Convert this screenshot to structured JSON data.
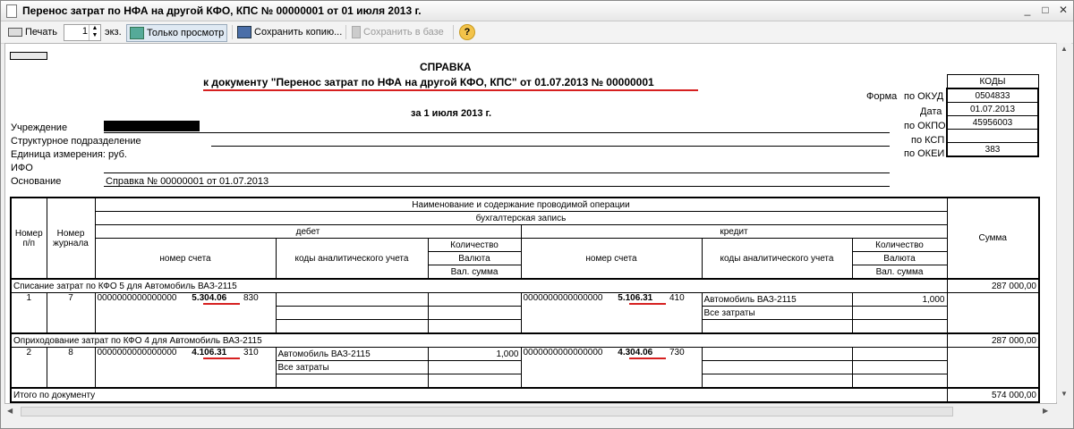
{
  "window": {
    "title": "Перенос затрат по НФА на другой КФО, КПС № 00000001 от 01 июля 2013 г.",
    "minimize": "_",
    "maximize": "□",
    "close": "✕"
  },
  "toolbar": {
    "print": "Печать",
    "copies": "1",
    "copies_unit": "экз.",
    "view_only": "Только просмотр",
    "save_copy": "Сохранить копию...",
    "save_db": "Сохранить в базе",
    "help": "?"
  },
  "doc": {
    "heading": "СПРАВКА",
    "subheading": "к документу \"Перенос затрат по НФА на другой КФО, КПС\" от 01.07.2013 № 00000001",
    "date_line": "за 1 июля 2013 г.",
    "fields": {
      "institution": "Учреждение",
      "division": "Структурное подразделение",
      "unit_label": "Единица измерения: руб.",
      "ifo": "ИФО",
      "basis_label": "Основание",
      "basis_value": "Справка № 00000001 от 01.07.2013"
    },
    "codes": {
      "header": "КОДЫ",
      "form_label": "Форма",
      "okud_label": "по ОКУД",
      "okud": "0504833",
      "date_label": "Дата",
      "date": "01.07.2013",
      "okpo_label": "по ОКПО",
      "okpo": "45956003",
      "ksp_label": "по КСП",
      "ksp": "",
      "okei_label": "по ОКЕИ",
      "okei": "383"
    },
    "table": {
      "h_num": "Номер п/п",
      "h_journal": "Номер журнала",
      "h_operation": "Наименование и содержание проводимой операции",
      "h_entry": "бухгалтерская запись",
      "h_debit": "дебет",
      "h_credit": "кредит",
      "h_sum": "Сумма",
      "h_account": "номер счета",
      "h_analytics": "коды аналитического учета",
      "h_qty": "Количество",
      "h_currency": "Валюта",
      "h_cur_sum": "Вал. сумма",
      "groups": [
        {
          "title": "Списание затрат по КФО 5 для  Автомобиль ВАЗ-2115",
          "total": "287 000,00",
          "num": "1",
          "journal": "7",
          "d_acc": "0000000000000000",
          "d_code": "5.304.06",
          "d_kosgu": "830",
          "d_an1": "",
          "d_an2": "",
          "d_an3": "",
          "d_qty": "",
          "c_acc": "0000000000000000",
          "c_code": "5.106.31",
          "c_kosgu": "410",
          "c_an1": "Автомобиль ВАЗ-2115",
          "c_an2": "Все затраты",
          "c_an3": "",
          "c_qty": "1,000"
        },
        {
          "title": "Оприходование затрат по КФО 4 для  Автомобиль ВАЗ-2115",
          "total": "287 000,00",
          "num": "2",
          "journal": "8",
          "d_acc": "0000000000000000",
          "d_code": "4.106.31",
          "d_kosgu": "310",
          "d_an1": "Автомобиль ВАЗ-2115",
          "d_an2": "Все затраты",
          "d_an3": "",
          "d_qty": "1,000",
          "c_acc": "0000000000000000",
          "c_code": "4.304.06",
          "c_kosgu": "730",
          "c_an1": "",
          "c_an2": "",
          "c_an3": "",
          "c_qty": ""
        }
      ],
      "total_label": "Итого по документу",
      "total": "574 000,00"
    }
  },
  "colors": {
    "annotation": "#d62020"
  }
}
